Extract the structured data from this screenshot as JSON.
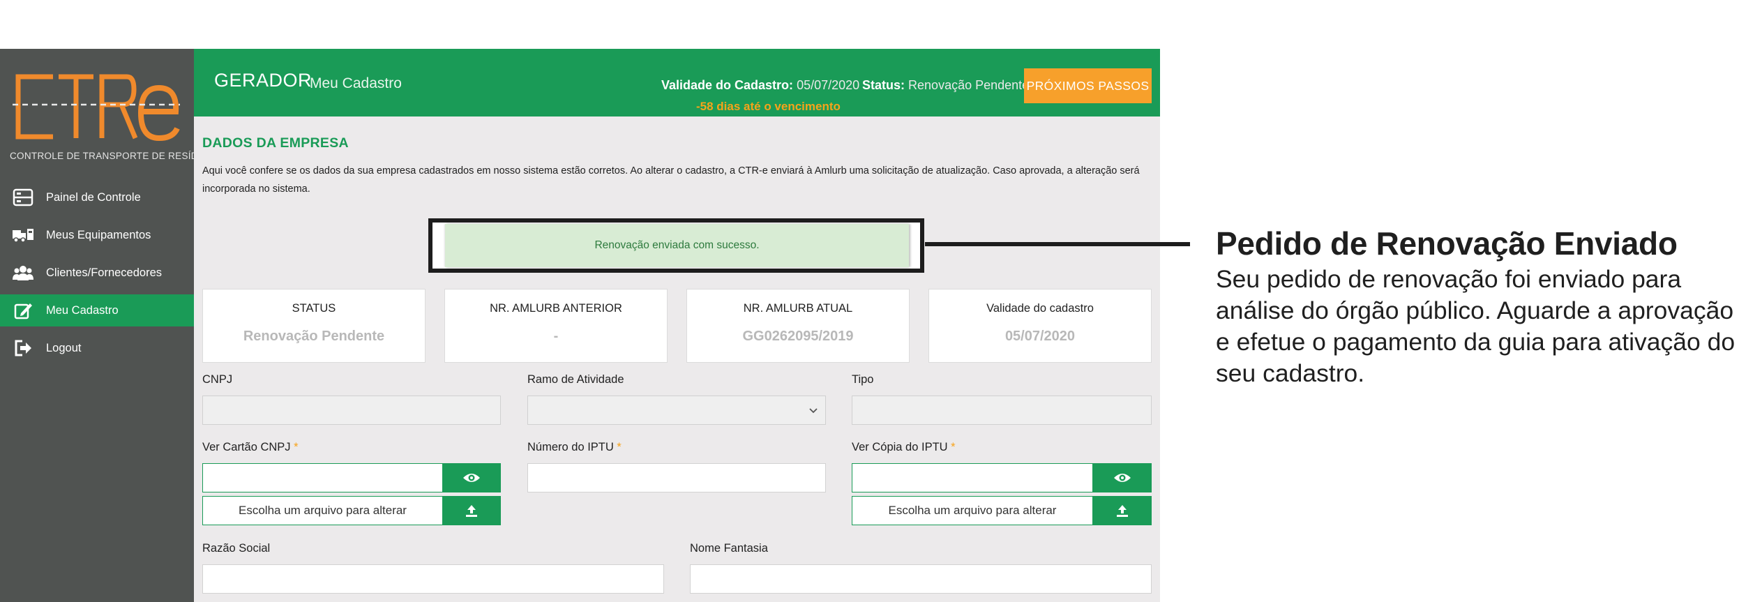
{
  "brand": {
    "logo_text": "CTRe",
    "logo_subtitle": "CONTROLE DE TRANSPORTE DE RESÍDUOS"
  },
  "sidebar": {
    "items": [
      {
        "label": "Painel de Controle",
        "icon": "dashboard-icon",
        "active": false
      },
      {
        "label": "Meus Equipamentos",
        "icon": "truck-icon",
        "active": false
      },
      {
        "label": "Clientes/Fornecedores",
        "icon": "users-icon",
        "active": false
      },
      {
        "label": "Meu Cadastro",
        "icon": "edit-icon",
        "active": true
      },
      {
        "label": "Logout",
        "icon": "logout-icon",
        "active": false
      }
    ]
  },
  "header": {
    "section": "GERADOR",
    "page": "Meu Cadastro",
    "validity_label": "Validade do Cadastro:",
    "validity_value": "05/07/2020",
    "status_label": "Status:",
    "status_value": "Renovação Pendente",
    "days_notice": "-58 dias até o vencimento",
    "next_steps_button": "PRÓXIMOS PASSOS"
  },
  "main": {
    "title": "DADOS DA EMPRESA",
    "description": "Aqui você confere se os dados da sua empresa cadastrados em nosso sistema estão corretos. Ao alterar o cadastro, a CTR-e enviará à Amlurb uma solicitação de atualização. Caso aprovada, a alteração será incorporada no sistema.",
    "success_message": "Renovação enviada com sucesso.",
    "cards": [
      {
        "label": "STATUS",
        "value": "Renovação Pendente"
      },
      {
        "label": "NR. AMLURB ANTERIOR",
        "value": "-"
      },
      {
        "label": "NR. AMLURB ATUAL",
        "value": "GG0262095/2019"
      },
      {
        "label": "Validade do cadastro",
        "value": "05/07/2020"
      }
    ],
    "fields": {
      "cnpj_label": "CNPJ",
      "ramo_label": "Ramo de Atividade",
      "tipo_label": "Tipo",
      "cartao_label": "Ver Cartão CNPJ",
      "iptu_label": "Número do IPTU",
      "copia_iptu_label": "Ver Cópia do IPTU",
      "required_mark": "*",
      "file_button": "Escolha um arquivo para alterar",
      "razao_label": "Razão Social",
      "fantasia_label": "Nome Fantasia"
    }
  },
  "annotation": {
    "title": "Pedido de Renovação Enviado",
    "body": "Seu pedido de renovação foi enviado para análise do órgão público. Aguarde a aprovação e efetue o pagamento da guia para ativação do seu cadastro."
  },
  "colors": {
    "primary_green": "#1a9b57",
    "accent_orange": "#f7a02b",
    "sidebar_gray": "#505351",
    "content_bg": "#eceaeb"
  }
}
